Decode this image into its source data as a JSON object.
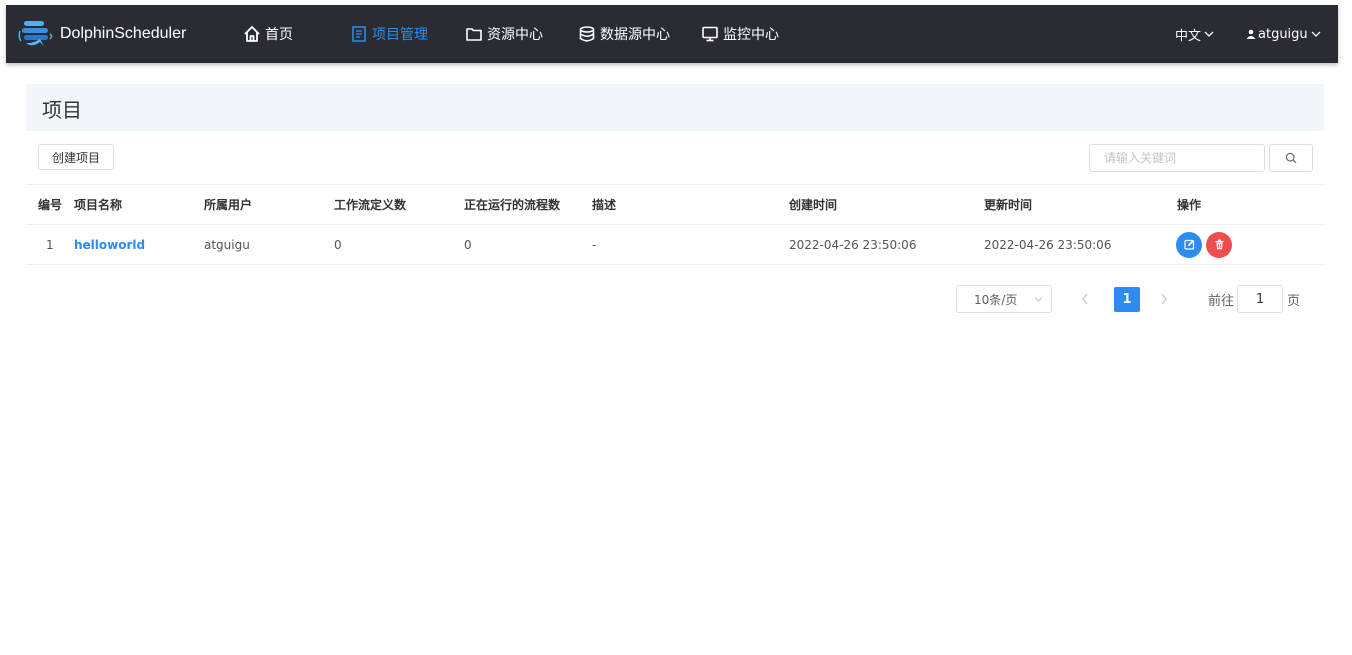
{
  "app": {
    "name": "DolphinScheduler"
  },
  "nav": [
    {
      "label": "首页",
      "icon": "home-icon",
      "active": false
    },
    {
      "label": "项目管理",
      "icon": "document-icon",
      "active": true
    },
    {
      "label": "资源中心",
      "icon": "folder-icon",
      "active": false
    },
    {
      "label": "数据源中心",
      "icon": "database-icon",
      "active": false
    },
    {
      "label": "监控中心",
      "icon": "monitor-icon",
      "active": false
    }
  ],
  "header_right": {
    "language": "中文",
    "user": "atguigu"
  },
  "page": {
    "title": "项目",
    "create_button": "创建项目",
    "search_placeholder": "请输入关键词"
  },
  "table": {
    "columns": [
      "编号",
      "项目名称",
      "所属用户",
      "工作流定义数",
      "正在运行的流程数",
      "描述",
      "创建时间",
      "更新时间",
      "操作"
    ],
    "rows": [
      {
        "index": "1",
        "name": "helloworld",
        "owner": "atguigu",
        "workflow_count": "0",
        "running_count": "0",
        "description": "-",
        "create_time": "2022-04-26 23:50:06",
        "update_time": "2022-04-26 23:50:06"
      }
    ]
  },
  "pagination": {
    "page_size": "10条/页",
    "current_page": "1",
    "goto_label": "前往",
    "goto_value": "1",
    "goto_suffix": "页"
  },
  "colors": {
    "topbar": "#292d33",
    "accent": "#2d8cf0",
    "danger": "#ed4f4f",
    "header_band": "#f2f6fb"
  }
}
